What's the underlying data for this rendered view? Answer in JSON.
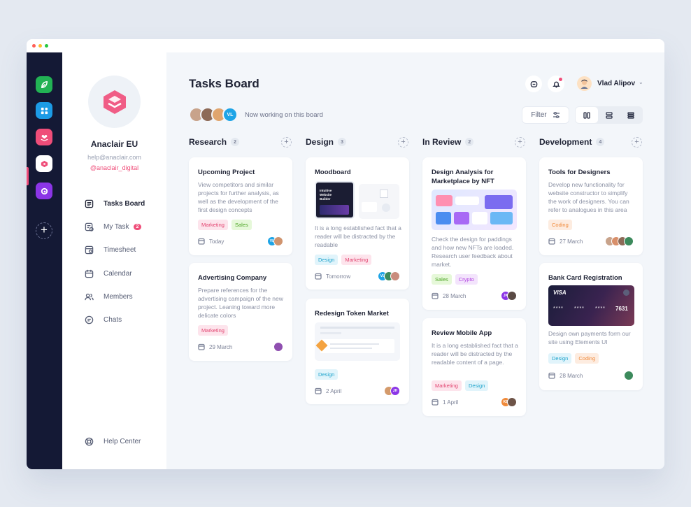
{
  "workspaces": [
    {
      "name": "leaf",
      "color": "#22b254"
    },
    {
      "name": "apps",
      "color": "#1c9be6"
    },
    {
      "name": "heart",
      "color": "#ef4d79"
    },
    {
      "name": "cube",
      "color": "#ffffff"
    },
    {
      "name": "swirl",
      "color": "#8b35e6"
    }
  ],
  "org": {
    "name": "Anaclair EU",
    "email": "help@anaclair.com",
    "handle": "@anaclair_digital"
  },
  "nav": [
    {
      "label": "Tasks Board",
      "icon": "board-icon",
      "active": true
    },
    {
      "label": "My Task",
      "icon": "task-icon",
      "badge": "2"
    },
    {
      "label": "Timesheet",
      "icon": "timesheet-icon"
    },
    {
      "label": "Calendar",
      "icon": "calendar-icon"
    },
    {
      "label": "Members",
      "icon": "members-icon"
    },
    {
      "label": "Chats",
      "icon": "chat-icon"
    }
  ],
  "help": "Help Center",
  "header": {
    "title": "Tasks Board",
    "user": "Vlad Alipov",
    "working": "Now working on this board",
    "board_avatar_initials": "VL",
    "filter": "Filter"
  },
  "columns": [
    {
      "name": "Research",
      "count": "2"
    },
    {
      "name": "Design",
      "count": "3"
    },
    {
      "name": "In Review",
      "count": "2"
    },
    {
      "name": "Development",
      "count": "4"
    }
  ],
  "cards": {
    "upcoming": {
      "title": "Upcoming Project",
      "desc": "View competitors and similar projects for further analysis, as well as the development of the first design concepts",
      "tags": [
        "Marketing",
        "Sales"
      ],
      "date": "Today",
      "initials": "VL"
    },
    "advertising": {
      "title": "Advertising Company",
      "desc": "Prepare references for the advertising campaign of the new project. Leaning toward more delicate colors",
      "tags": [
        "Marketing"
      ],
      "date": "29 March"
    },
    "moodboard": {
      "title": "Moodboard",
      "img_text": "Intuitive Website Builder",
      "desc": "It is a long established fact that a reader will be distracted by the readable",
      "tags": [
        "Design",
        "Marketing"
      ],
      "date": "Tomorrow",
      "initials": "VL"
    },
    "token": {
      "title": "Redesign Token Market",
      "tags": [
        "Design"
      ],
      "date": "2 April",
      "initials": "JH"
    },
    "analysis": {
      "title": "Design Analysis for Marketplace by NFT",
      "desc": "Check the design for paddings and how new NFTs are loaded. Research user feedback about market.",
      "tags": [
        "Sales",
        "Crypto"
      ],
      "date": "28 March",
      "initials": "JK"
    },
    "mobile": {
      "title": "Review Mobile App",
      "desc": "It is a long established fact that a reader will be distracted by the readable content of a page.",
      "tags": [
        "Marketing",
        "Design"
      ],
      "date": "1 April",
      "initials": "KE"
    },
    "tools": {
      "title": "Tools for Designers",
      "desc": "Develop new functionality for website constructor to simplify the work of designers. You can refer to analogues in this area",
      "tags": [
        "Coding"
      ],
      "date": "27 March"
    },
    "bank": {
      "title": "Bank Card Registration",
      "card_brand": "VISA",
      "card_mask": "****",
      "card_last": "7631",
      "desc": "Design own payments form our site using Elements UI",
      "tags": [
        "Design",
        "Coding"
      ],
      "date": "28 March"
    }
  },
  "colors": {
    "accent": "#ef4d79",
    "rail": "#141935"
  }
}
